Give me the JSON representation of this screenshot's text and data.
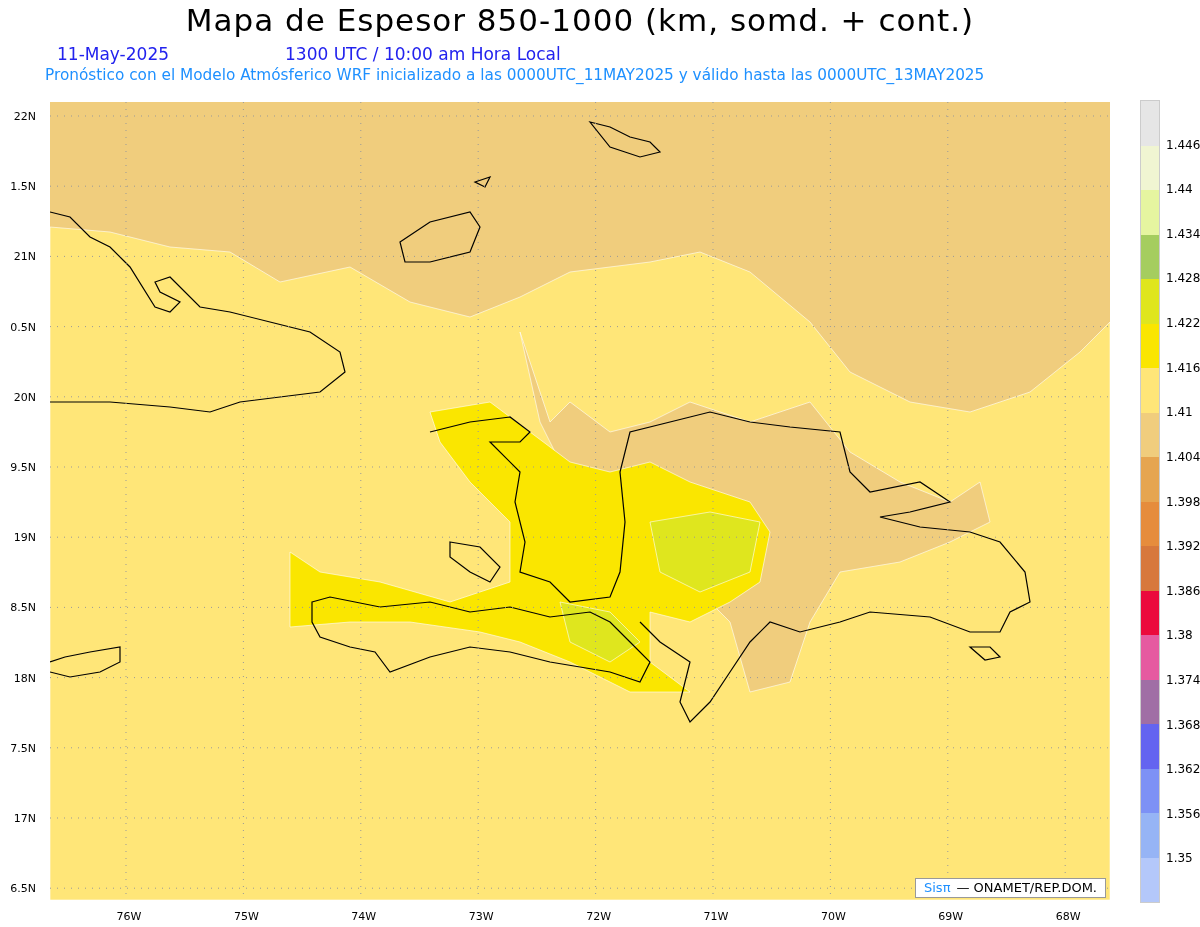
{
  "title": "Mapa de Espesor 850-1000 (km, somd. + cont.)",
  "date": "11-May-2025",
  "time": "1300 UTC / 10:00 am Hora Local",
  "subtitle": "Pronóstico con el Modelo Atmósferico WRF inicializado a las 0000UTC_11MAY2025 y válido hasta las  0000UTC_13MAY2025",
  "y_axis": [
    "22N",
    "1.5N",
    "21N",
    "0.5N",
    "20N",
    "9.5N",
    "19N",
    "8.5N",
    "18N",
    "7.5N",
    "17N",
    "6.5N"
  ],
  "x_axis": [
    "76W",
    "75W",
    "74W",
    "73W",
    "72W",
    "71W",
    "70W",
    "69W",
    "68W"
  ],
  "colorbar": {
    "swatches": [
      {
        "color": "#e6e6e6"
      },
      {
        "color": "#f0f5d2"
      },
      {
        "color": "#e6f5a0"
      },
      {
        "color": "#a5cd5f"
      },
      {
        "color": "#dfe61e"
      },
      {
        "color": "#fae600"
      },
      {
        "color": "#ffe678"
      },
      {
        "color": "#f0cd7d"
      },
      {
        "color": "#e6a550"
      },
      {
        "color": "#e68c3c"
      },
      {
        "color": "#d7783c"
      },
      {
        "color": "#eb0a3c"
      },
      {
        "color": "#e65aa0"
      },
      {
        "color": "#a06ea5"
      },
      {
        "color": "#6464f0"
      },
      {
        "color": "#7d91f5"
      },
      {
        "color": "#96b4f5"
      },
      {
        "color": "#b4c8fa"
      }
    ],
    "labels": [
      "1.446",
      "1.44",
      "1.434",
      "1.428",
      "1.422",
      "1.416",
      "1.41",
      "1.404",
      "1.398",
      "1.392",
      "1.386",
      "1.38",
      "1.374",
      "1.368",
      "1.362",
      "1.356",
      "1.35"
    ]
  },
  "credit": {
    "logo": "Sisπ",
    "text": "— ONAMET/REP.DOM."
  }
}
